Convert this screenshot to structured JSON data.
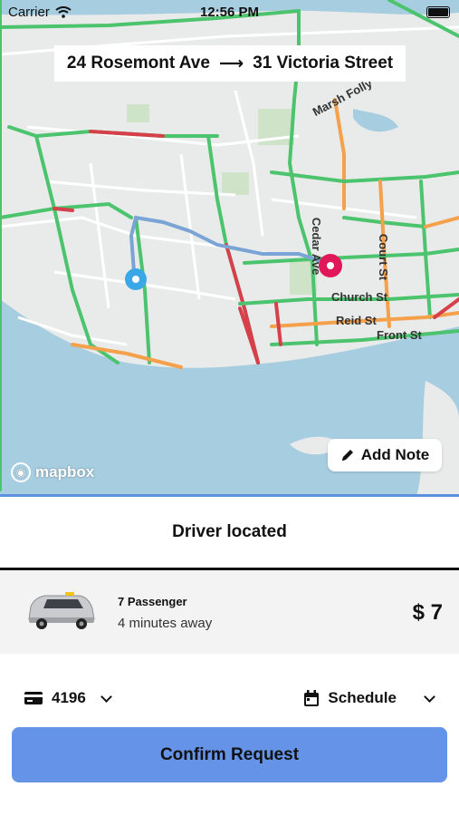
{
  "status_bar": {
    "carrier": "Carrier",
    "time": "12:56 PM"
  },
  "map": {
    "route_from": "24 Rosemont Ave",
    "route_to": "31 Victoria Street",
    "streets": [
      "Marsh Folly",
      "Cedar Ave",
      "Court St",
      "Church St",
      "Reid St",
      "Front St"
    ],
    "attribution": "mapbox",
    "add_note_label": "Add Note",
    "colors": {
      "water": "#a7cde0",
      "land": "#e9ebea",
      "road_green": "#4cc46e",
      "road_orange": "#f5a04a",
      "road_red": "#d6404a",
      "route": "#7aa4d6",
      "origin": "#3aa7e6",
      "destination": "#e0185a"
    }
  },
  "status_title": "Driver located",
  "ride": {
    "name": "7 Passenger",
    "eta": "4 minutes away",
    "price": "$ 7"
  },
  "payment": {
    "card_last4": "4196",
    "icon": "credit-card-icon"
  },
  "schedule": {
    "label": "Schedule",
    "icon": "calendar-icon"
  },
  "confirm_label": "Confirm Request"
}
